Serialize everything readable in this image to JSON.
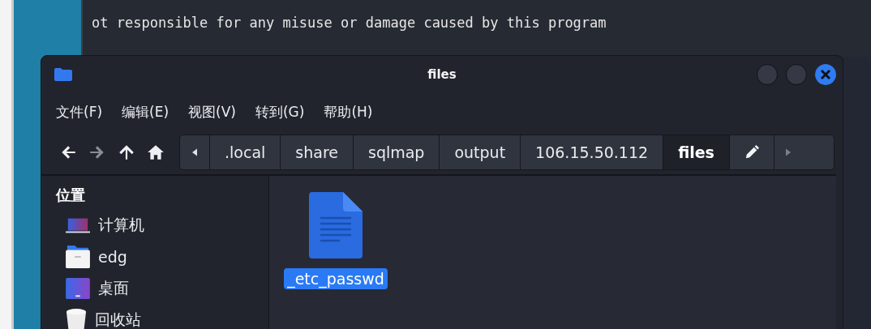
{
  "terminal": {
    "line": "ot responsible for any misuse or damage caused by this program"
  },
  "window": {
    "title": "files"
  },
  "menu": [
    "文件(F)",
    "编辑(E)",
    "视图(V)",
    "转到(G)",
    "帮助(H)"
  ],
  "nav": [
    {
      "kind": "back",
      "disabled": false
    },
    {
      "kind": "forward",
      "disabled": true
    },
    {
      "kind": "up",
      "disabled": false
    },
    {
      "kind": "home",
      "disabled": false
    }
  ],
  "path": [
    {
      "label": ".local",
      "selected": false
    },
    {
      "label": "share",
      "selected": false
    },
    {
      "label": "sqlmap",
      "selected": false
    },
    {
      "label": "output",
      "selected": false
    },
    {
      "label": "106.15.50.112",
      "selected": false
    },
    {
      "label": "files",
      "selected": true
    }
  ],
  "sidebar": {
    "heading": "位置",
    "items": [
      {
        "label": "计算机",
        "kind": "computer"
      },
      {
        "label": "edg",
        "kind": "home"
      },
      {
        "label": "桌面",
        "kind": "desktop"
      },
      {
        "label": "回收站",
        "kind": "trash"
      }
    ]
  },
  "files": [
    {
      "name": "_etc_passwd",
      "selected": true
    }
  ]
}
